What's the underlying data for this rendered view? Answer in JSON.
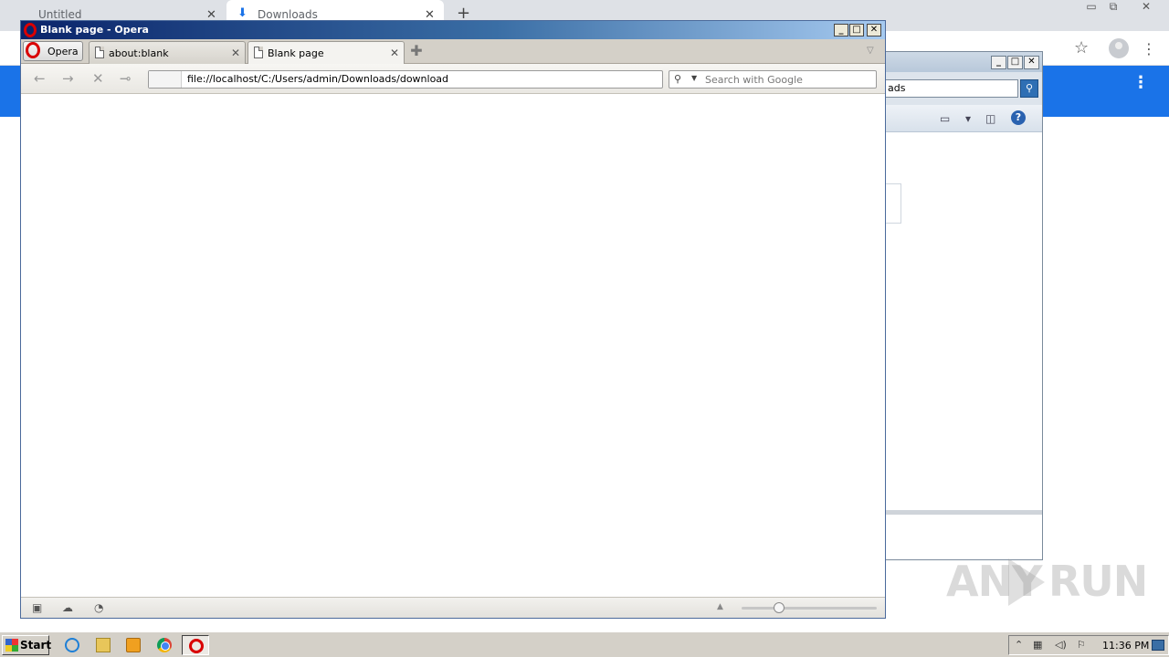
{
  "chrome": {
    "tabs": [
      {
        "label": "Untitled"
      },
      {
        "label": "Downloads"
      }
    ],
    "close_glyph": "✕",
    "new_tab_glyph": "+",
    "window_controls": [
      "▭",
      "⧉",
      "✕"
    ],
    "star_glyph": "☆",
    "menu_glyph": "⋮",
    "banner_color": "#1a73e8"
  },
  "explorer": {
    "search_value": "ads",
    "search_glyph": "⚲",
    "window_controls": [
      "_",
      "□",
      "✕"
    ],
    "cmd_icons": [
      "▭",
      "▾",
      "◫"
    ],
    "help_glyph": "?"
  },
  "opera": {
    "title": "Blank page - Opera",
    "window_controls": [
      "_",
      "□",
      "✕"
    ],
    "menu_label": "Opera",
    "tabs": [
      {
        "label": "about:blank",
        "active": false
      },
      {
        "label": "Blank page",
        "active": true
      }
    ],
    "tab_close_glyph": "✕",
    "new_tab_glyph": "✚",
    "tab_menu_glyph": "▽",
    "nav": {
      "back": "←",
      "forward": "→",
      "stop": "✕",
      "key": "⊸"
    },
    "address": "file://localhost/C:/Users/admin/Downloads/download",
    "search_placeholder": "Search with Google",
    "search_icon": "⚲",
    "search_caret": "▼",
    "statusbar_icons": [
      "▣",
      "☁",
      "◔"
    ],
    "zoom_up_glyph": "▲",
    "zoom_level": 0.28
  },
  "watermark": {
    "part1": "ANY",
    "part2": "RUN"
  },
  "taskbar": {
    "start_label": "Start",
    "tray_glyphs": [
      "⌃",
      "▦",
      "◁)",
      "⚐"
    ],
    "clock": "11:36 PM"
  }
}
